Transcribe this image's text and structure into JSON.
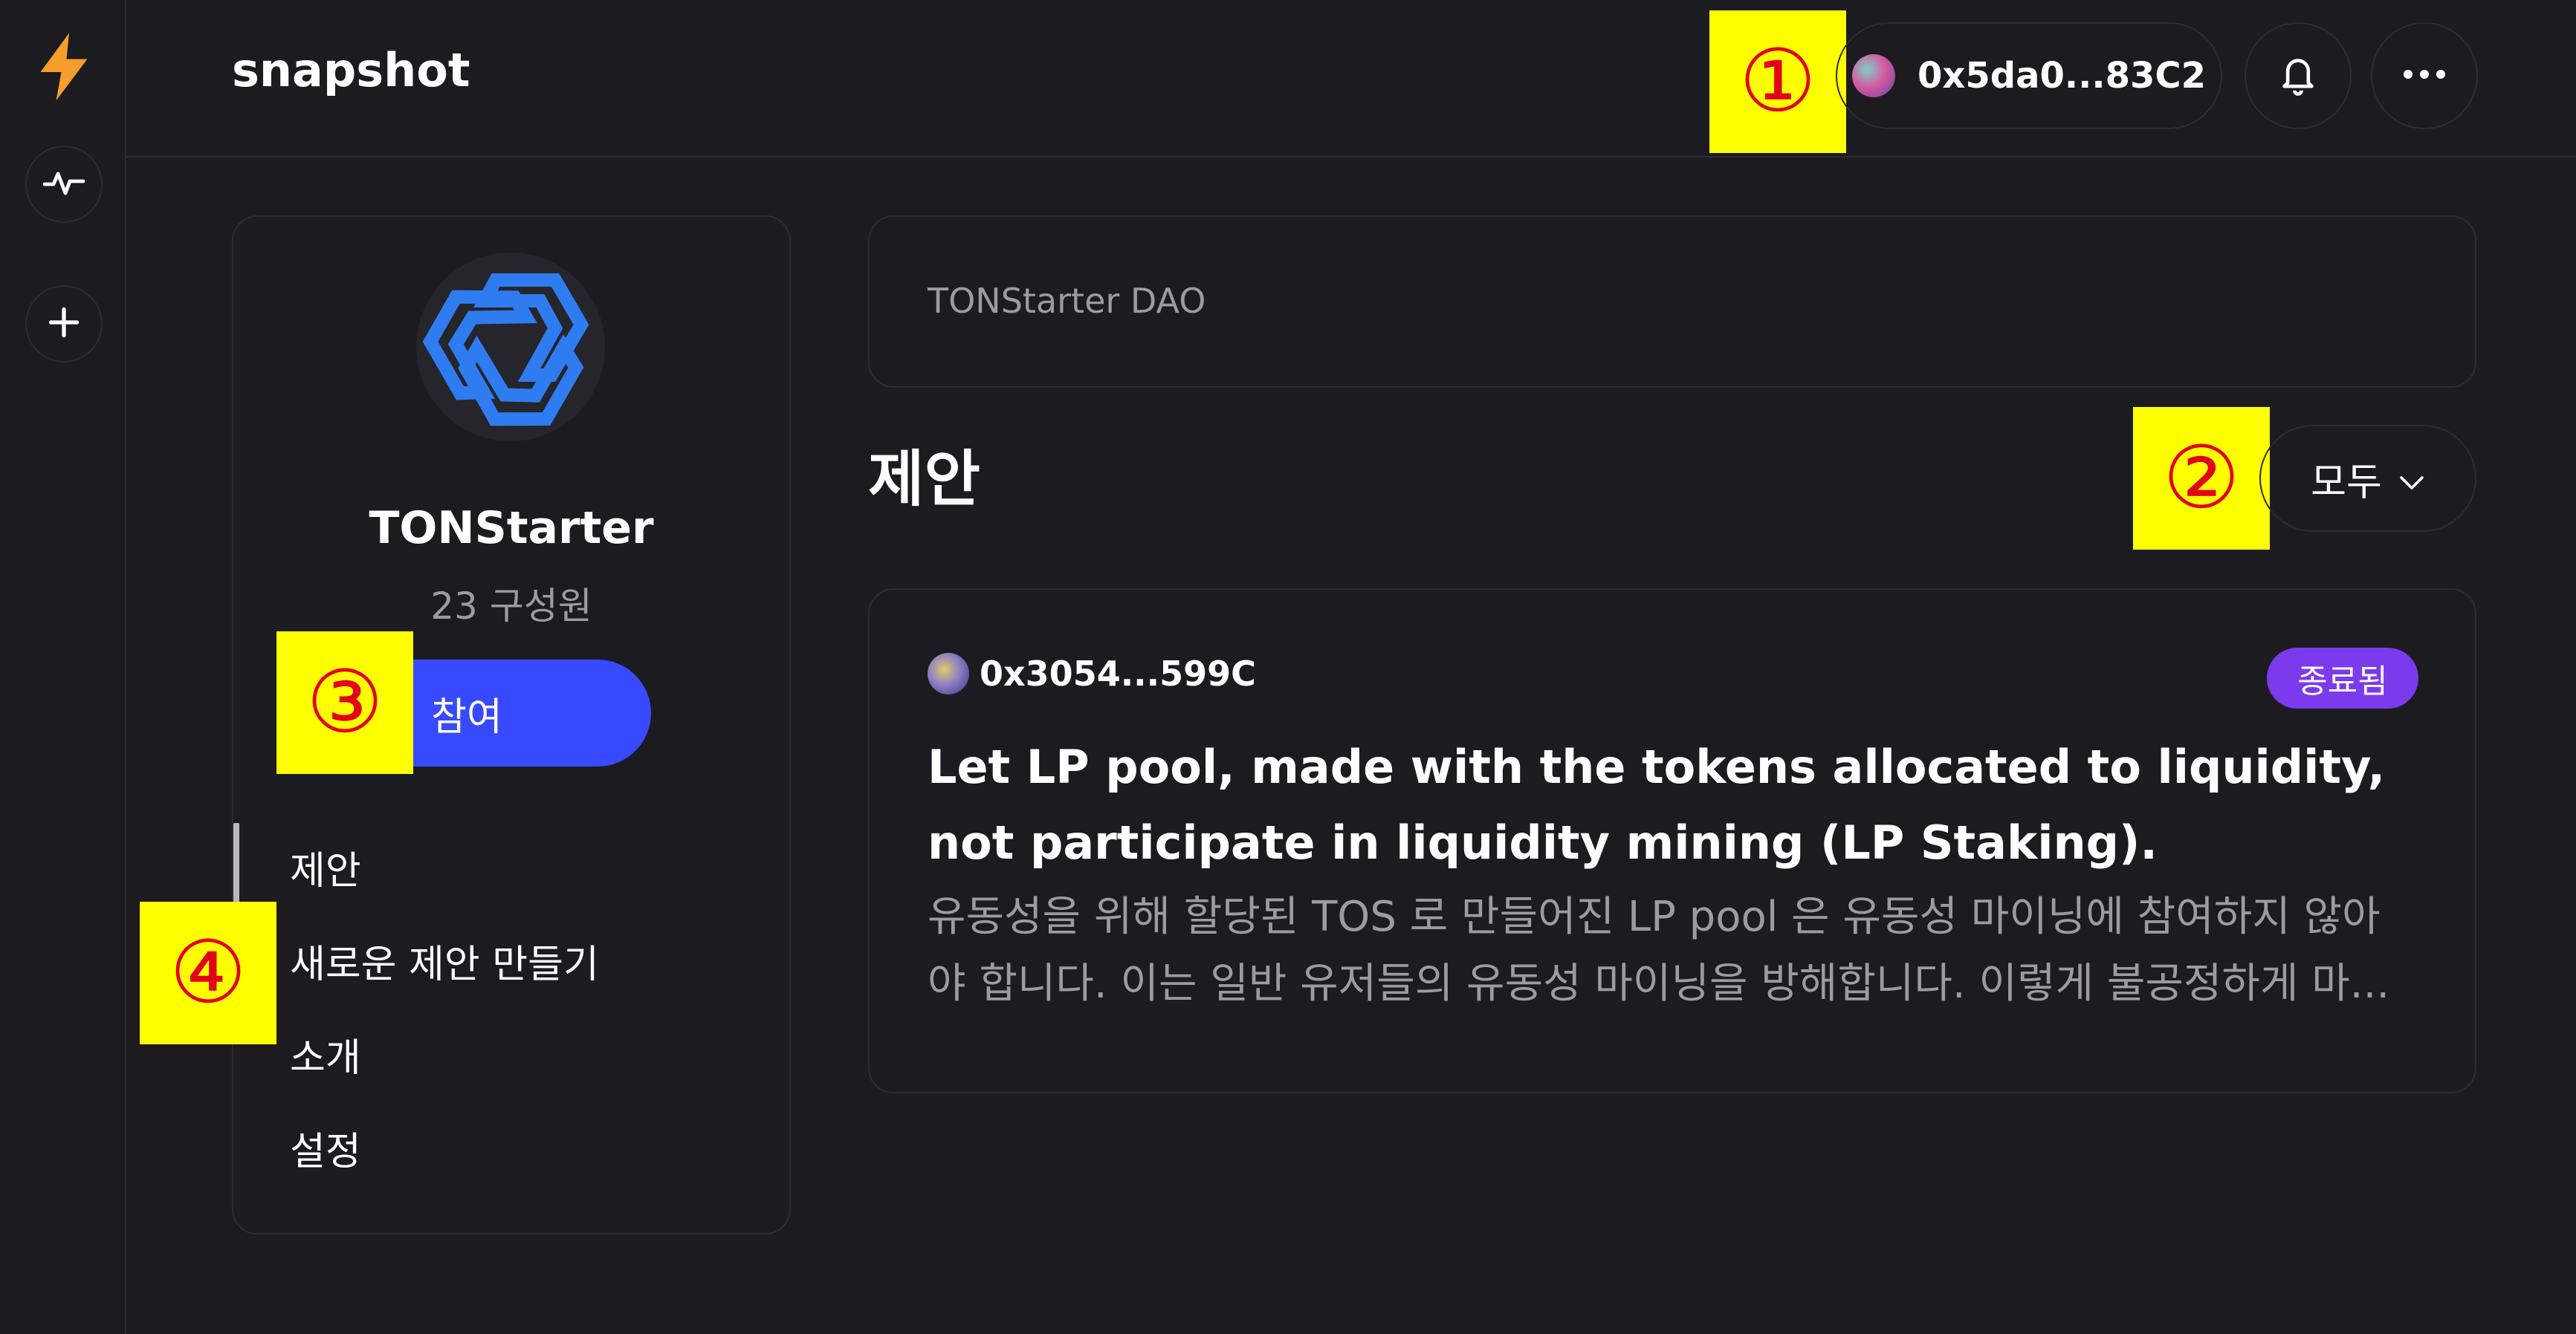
{
  "header": {
    "brand": "snapshot",
    "wallet_address": "0x5da0...83C2"
  },
  "space": {
    "name": "TONStarter",
    "members": "23 구성원",
    "join_label": "참여",
    "header_title": "TONStarter DAO",
    "nav": [
      {
        "label": "제안",
        "active": true
      },
      {
        "label": "새로운 제안 만들기",
        "active": false
      },
      {
        "label": "소개",
        "active": false
      },
      {
        "label": "설정",
        "active": false
      }
    ]
  },
  "proposals_section": {
    "title": "제안",
    "filter_label": "모두"
  },
  "proposal": {
    "author": "0x3054...599C",
    "status": "종료됨",
    "title_line1": "Let LP pool, made with the tokens allocated to liquidity,",
    "title_line2": "not participate in liquidity mining (LP Staking).",
    "body_line1": "유동성을 위해 할당된 TOS 로 만들어진 LP pool 은 유동성 마이닝에 참여하지 않아",
    "body_line2": "야 합니다. 이는 일반 유저들의 유동성 마이닝을 방해합니다. 이렇게 불공정하게 마..."
  },
  "callouts": [
    "①",
    "②",
    "③",
    "④"
  ],
  "icons": {
    "rail": [
      "lightning-icon",
      "activity-icon",
      "plus-icon"
    ],
    "topbar": [
      "bell-icon",
      "more-horizontal-icon"
    ],
    "filter": "chevron-down-icon"
  },
  "colors": {
    "background": "#1c1b20",
    "border": "#2d2c33",
    "accent_blue": "#384aff",
    "status_purple": "#7c3aed",
    "bolt_orange": "#f59e2b",
    "muted_text": "#9b9ba2",
    "callout_yellow": "#ffff00",
    "callout_red": "#e3001b"
  }
}
